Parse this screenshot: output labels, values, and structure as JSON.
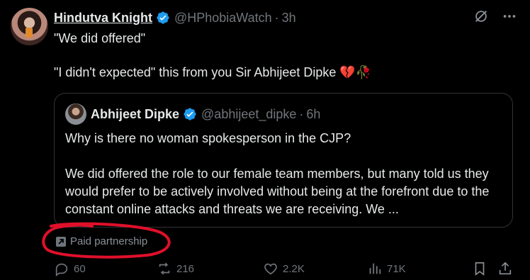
{
  "tweet": {
    "author_name": "Hindutva Knight",
    "handle": "@HPhobiaWatch",
    "separator": "·",
    "time": "3h",
    "text": "\"We did offered\"\n\n\"I didn't expected\" this from you Sir Abhijeet Dipke 💔🥀"
  },
  "quoted": {
    "author_name": "Abhijeet Dipke",
    "handle": "@abhijeet_dipke",
    "separator": "·",
    "time": "6h",
    "text": "Why is there no woman spokesperson in the CJP?\n\nWe did offered the role to our female team members, but many told us they would prefer to be actively involved without being at the forefront due to the constant online attacks and threats we are receiving. We ..."
  },
  "paid_label": "Paid partnership",
  "actions": {
    "replies": "60",
    "reposts": "216",
    "likes": "2.2K",
    "views": "71K"
  },
  "icons": {
    "verified": "verified-badge-icon",
    "grok": "grok-icon",
    "more": "more-icon",
    "paid": "arrow-up-right-icon",
    "reply": "reply-icon",
    "repost": "repost-icon",
    "like": "heart-icon",
    "views": "views-icon",
    "bookmark": "bookmark-icon",
    "share": "share-icon"
  },
  "colors": {
    "background": "#000000",
    "text": "#e7e9ea",
    "muted": "#71767b",
    "verified": "#1d9bf0",
    "annotation": "#e0102a"
  }
}
